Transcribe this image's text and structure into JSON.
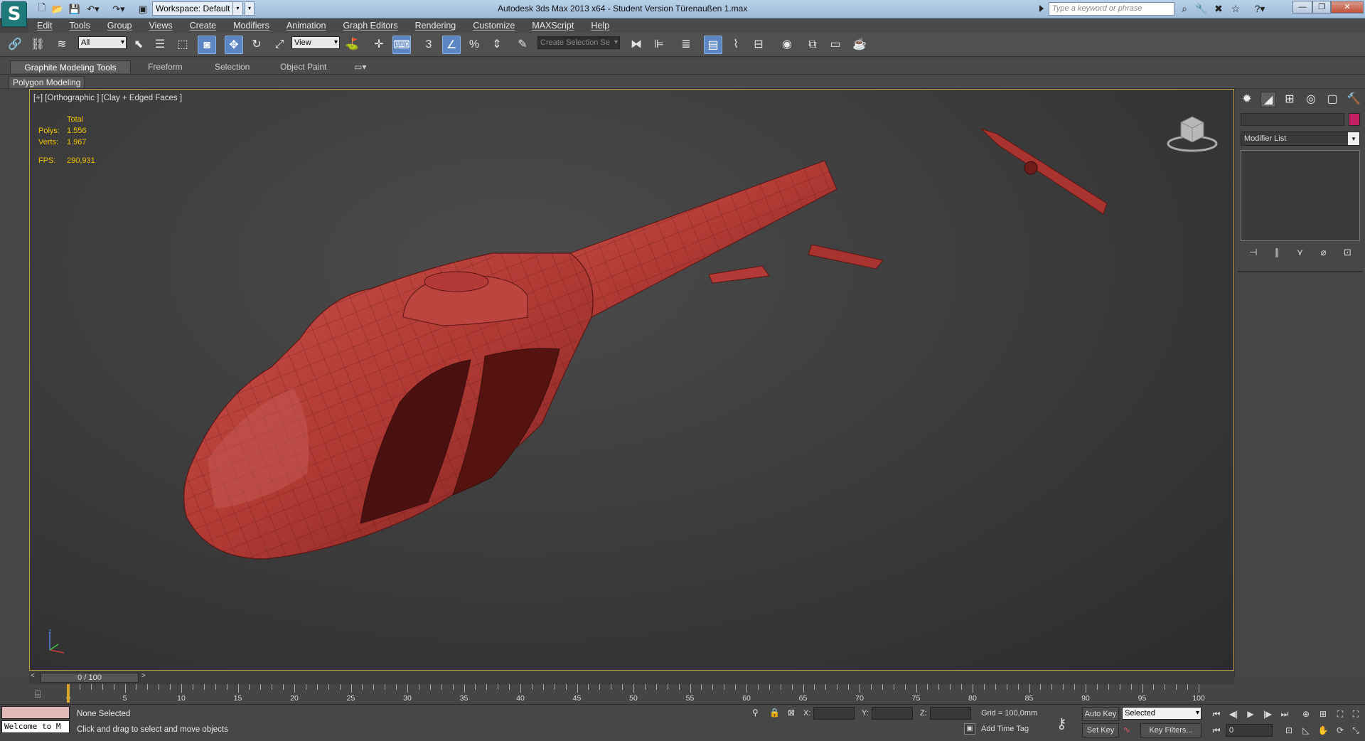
{
  "titlebar": {
    "workspace": "Workspace: Default",
    "title": "Autodesk 3ds Max  2013 x64   - Student Version    Türenaußen 1.max",
    "search_placeholder": "Type a keyword or phrase"
  },
  "menu": [
    "Edit",
    "Tools",
    "Group",
    "Views",
    "Create",
    "Modifiers",
    "Animation",
    "Graph Editors",
    "Rendering",
    "Customize",
    "MAXScript",
    "Help"
  ],
  "toolbar": {
    "selection_filter": "All",
    "ref_coord": "View",
    "named_selection": "Create Selection Se"
  },
  "ribbon": {
    "tabs": [
      "Graphite Modeling Tools",
      "Freeform",
      "Selection",
      "Object Paint"
    ],
    "panel_label": "Polygon Modeling"
  },
  "viewport": {
    "label": "[+] [Orthographic ] [Clay + Edged Faces ]",
    "stats_header": "Total",
    "polys_label": "Polys:",
    "polys": "1.556",
    "verts_label": "Verts:",
    "verts": "1.967",
    "fps_label": "FPS:",
    "fps": "290,931",
    "model_color": "#b33a36"
  },
  "command_panel": {
    "modifier_list": "Modifier List",
    "object_color": "#c42063"
  },
  "timeline": {
    "slider": "0 / 100",
    "ticks": [
      "0",
      "5",
      "10",
      "15",
      "20",
      "25",
      "30",
      "35",
      "40",
      "45",
      "50",
      "55",
      "60",
      "65",
      "70",
      "75",
      "80",
      "85",
      "90",
      "95",
      "100"
    ]
  },
  "status": {
    "maxscript_text": "Welcome to M",
    "selection": "None Selected",
    "prompt": "Click and drag to select and move objects",
    "x_label": "X:",
    "y_label": "Y:",
    "z_label": "Z:",
    "grid": "Grid = 100,0mm",
    "add_time_tag": "Add Time Tag",
    "auto_key": "Auto Key",
    "set_key": "Set Key",
    "key_mode": "Selected",
    "key_filters": "Key Filters...",
    "frame": "0"
  }
}
